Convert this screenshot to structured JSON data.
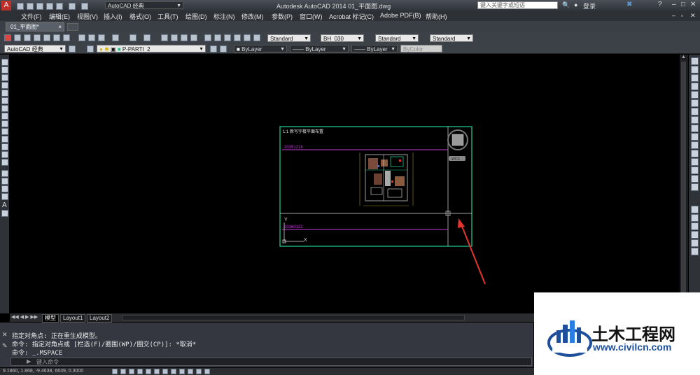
{
  "app": {
    "title": "Autodesk AutoCAD 2014    01_平面图.dwg",
    "workspace": "AutoCAD 经典",
    "search_placeholder": "键入关键字或短语",
    "login": "登录"
  },
  "menu": [
    "文件(F)",
    "编辑(E)",
    "视图(V)",
    "插入(I)",
    "格式(O)",
    "工具(T)",
    "绘图(D)",
    "标注(N)",
    "修改(M)",
    "参数(P)",
    "窗口(W)",
    "帮助(H)",
    "Acrobat 标记(C)",
    "Adobe PDF(B)"
  ],
  "doc_tab": "01_平面图*",
  "toolbar": {
    "text_style": "Standard",
    "dim_style": "BH_030",
    "table_style": "Standard",
    "mleader_style": "Standard",
    "workspace_dd": "AutoCAD 经典",
    "layer": "P-PARTI_2",
    "color": "ByLayer",
    "linetype": "ByLayer",
    "lineweight": "ByLayer",
    "plotstyle": "ByColor"
  },
  "drawing": {
    "title_text": "1:1 新写字楼平面布置",
    "date1": "20151218",
    "date2": "20160122",
    "viewcube_label": "WCS",
    "ucs_y": "Y",
    "ucs_x": "X"
  },
  "layout_tabs": [
    "模型",
    "Layout1",
    "Layout2"
  ],
  "command": {
    "line1": "指定对角点: 正在重生成模型。",
    "line2": "命令: 指定对角点或 [栏选(F)/圈围(WP)/圈交(CP)]: *取消*",
    "line3": "命令: _.MSPACE",
    "placeholder": "键入命令"
  },
  "status": {
    "coords": "9.1860, 1.868,  -9.4638,  6639,  0.3000"
  },
  "watermark": {
    "name": "土木工程网",
    "url": "www.civilcn.com"
  },
  "colors": {
    "frame": "#1ec28b",
    "magenta": "#c23bd6",
    "arrow": "#e3352d",
    "wm_blue": "#1e4f9c"
  }
}
